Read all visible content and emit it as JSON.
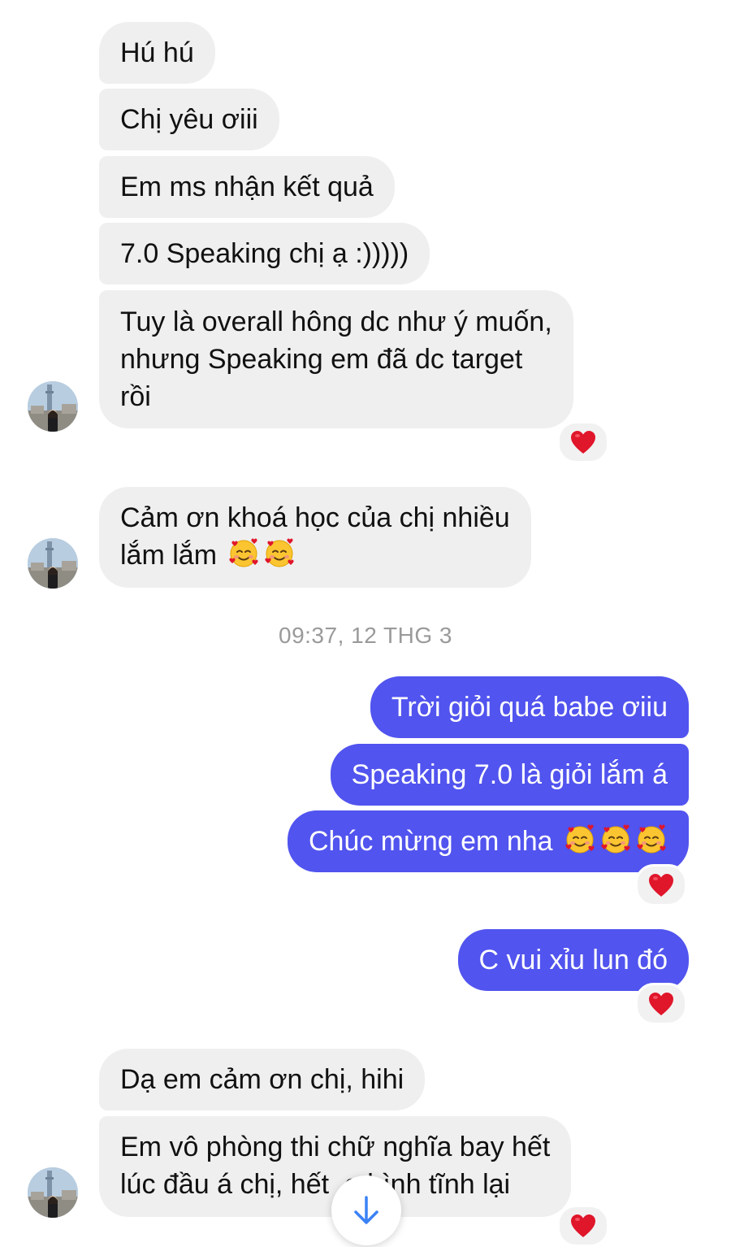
{
  "timestamp": "09:37, 12 THG 3",
  "messages": {
    "m1": "Hú hú",
    "m2": "Chị yêu ơiii",
    "m3": "Em ms nhận kết quả",
    "m4": "7.0 Speaking chị ạ :)))))",
    "m5": "Tuy là overall hông dc như ý muốn,\nnhưng Speaking em đã dc target\nrồi",
    "m6_text": "Cảm ơn khoá học của chị nhiều\nlắm lắm ",
    "o1": "Trời giỏi quá babe ơiiu",
    "o2": "Speaking 7.0 là giỏi lắm á",
    "o3_text": "Chúc mừng em nha ",
    "o4": "C vui xỉu lun đó",
    "m7": "Dạ em cảm ơn chị, hihi",
    "m8": "Em vô phòng thi chữ nghĩa bay hết\nlúc đầu á chị, hết  o bình tĩnh lại"
  },
  "colors": {
    "incoming_bubble": "#efefef",
    "outgoing_bubble": "#5154ee",
    "reaction_heart": "#e0162b",
    "scroll_arrow": "#3b82f6"
  },
  "icons": {
    "reaction": "red-heart-icon",
    "emoji": "smiling-face-with-hearts-emoji",
    "scroll": "arrow-down-icon"
  }
}
